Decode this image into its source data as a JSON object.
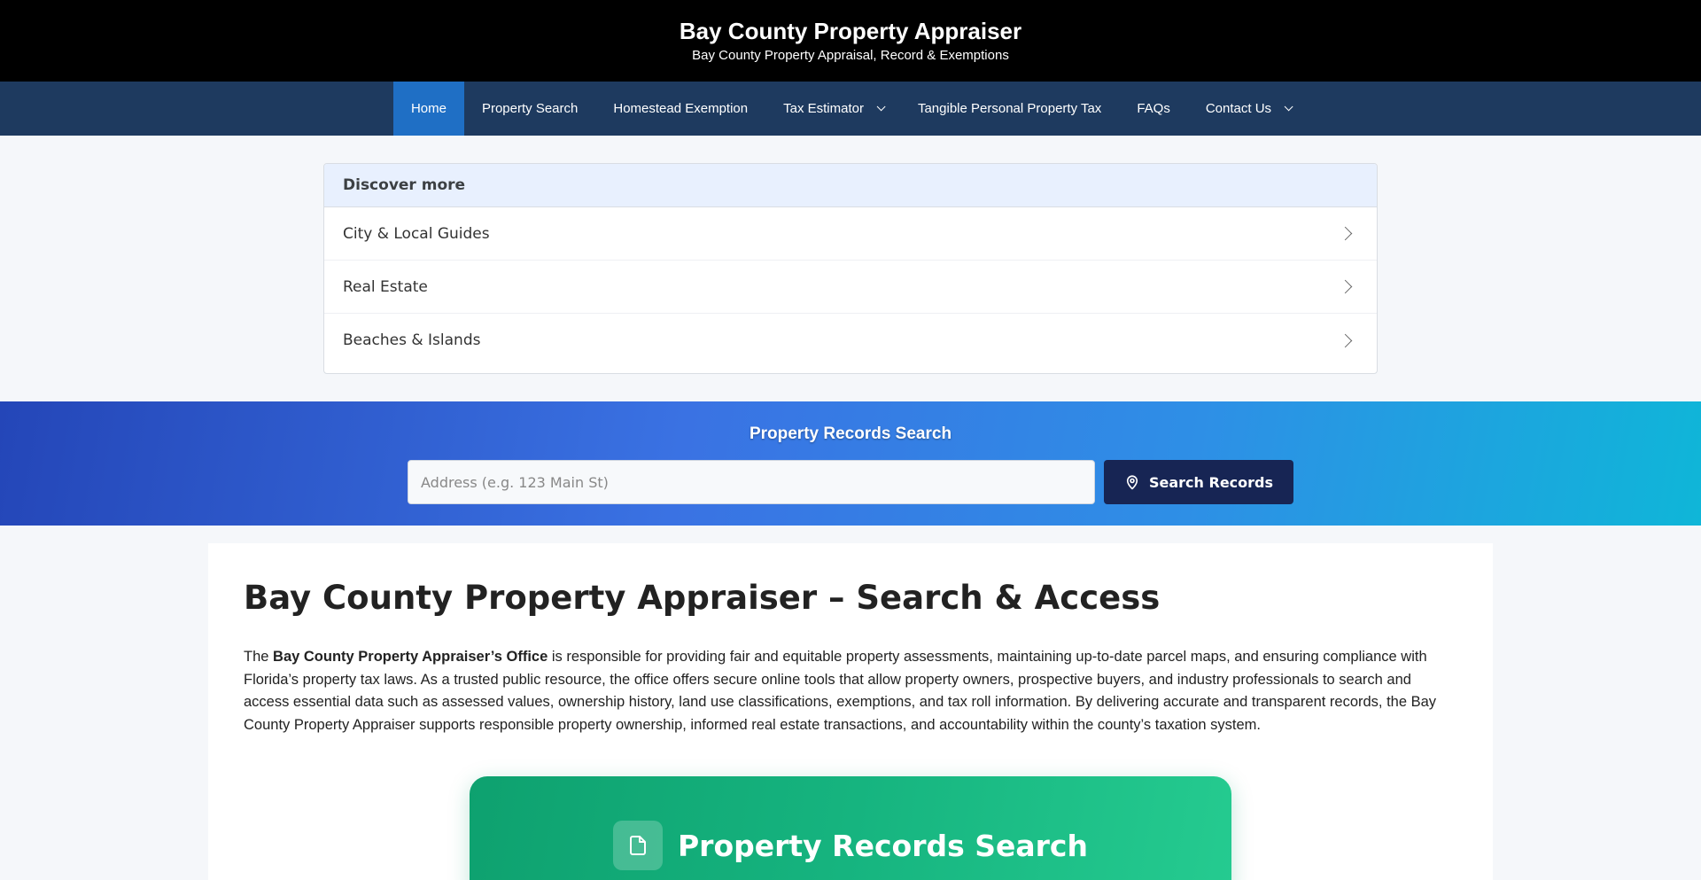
{
  "header": {
    "title": "Bay County Property Appraiser",
    "tagline": "Bay County Property Appraisal, Record & Exemptions"
  },
  "nav": {
    "home": "Home",
    "property_search": "Property Search",
    "homestead": "Homestead Exemption",
    "tax_estimator": "Tax Estimator",
    "tangible": "Tangible Personal Property Tax",
    "faqs": "FAQs",
    "contact": "Contact Us"
  },
  "discover": {
    "heading": "Discover more",
    "items": [
      {
        "label": "City & Local Guides"
      },
      {
        "label": "Real Estate"
      },
      {
        "label": "Beaches & Islands"
      }
    ]
  },
  "search_band": {
    "title": "Property Records Search",
    "placeholder": "Address (e.g. 123 Main St)",
    "button_label": "Search Records"
  },
  "content": {
    "title": "Bay County Property Appraiser – Search & Access",
    "para_prefix": "The ",
    "para_bold": "Bay County Property Appraiser’s Office",
    "para_rest": " is responsible for providing fair and equitable property assessments, maintaining up-to-date parcel maps, and ensuring compliance with Florida’s property tax laws. As a trusted public resource, the office offers secure online tools that allow property owners, prospective buyers, and industry professionals to search and access essential data such as assessed values, ownership history, land use classifications, exemptions, and tax roll information. By delivering accurate and transparent records, the Bay County Property Appraiser supports responsible property ownership, informed real estate transactions, and accountability within the county’s taxation system."
  },
  "card": {
    "title": "Property Records Search",
    "icon": "document-icon"
  }
}
